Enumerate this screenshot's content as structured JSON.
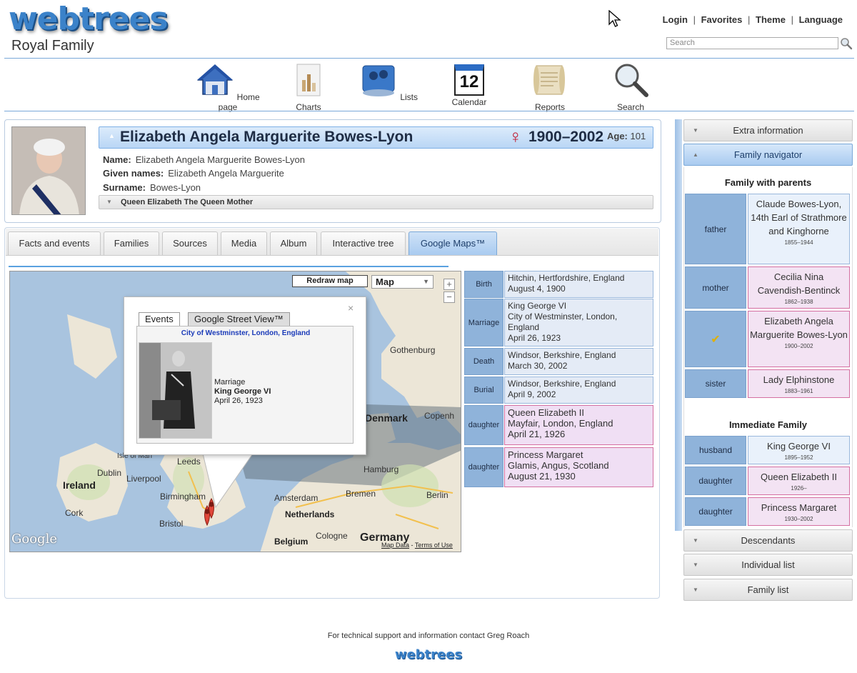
{
  "header": {
    "logo": "webtrees",
    "site_title": "Royal Family",
    "links": [
      "Login",
      "Favorites",
      "Theme",
      "Language"
    ],
    "search_placeholder": "Search"
  },
  "menu": [
    {
      "label": "Home page",
      "icon": "home-icon"
    },
    {
      "label": "Charts",
      "icon": "charts-icon"
    },
    {
      "label": "Lists",
      "icon": "lists-icon"
    },
    {
      "label": "Calendar",
      "icon": "calendar-icon",
      "day": "12"
    },
    {
      "label": "Reports",
      "icon": "reports-icon"
    },
    {
      "label": "Search",
      "icon": "search-icon"
    }
  ],
  "individual": {
    "name": "Elizabeth Angela Marguerite Bowes-Lyon",
    "sex_symbol": "♀",
    "life_span": "1900–2002",
    "age_label": "Age:",
    "age": "101",
    "facts": [
      {
        "label": "Name:",
        "value": "Elizabeth Angela Marguerite Bowes-Lyon"
      },
      {
        "label": "Given names:",
        "value": "Elizabeth Angela Marguerite"
      },
      {
        "label": "Surname:",
        "value": "Bowes-Lyon"
      }
    ],
    "title_bar": "Queen Elizabeth The Queen Mother"
  },
  "tabs": [
    "Facts and events",
    "Families",
    "Sources",
    "Media",
    "Album",
    "Interactive tree",
    "Google Maps™"
  ],
  "active_tab": "Google Maps™",
  "map": {
    "redraw_label": "Redraw map",
    "map_type": "Map",
    "zoom_in": "+",
    "zoom_out": "−",
    "google_logo": "Google",
    "footer_links": [
      "Map Data",
      "Terms of Use"
    ],
    "labels": [
      {
        "text": "Gothenburg",
        "big": false
      },
      {
        "text": "Denmark",
        "big": true
      },
      {
        "text": "Copenh",
        "big": false
      },
      {
        "text": "Isle of Man",
        "big": false
      },
      {
        "text": "Leeds",
        "big": false
      },
      {
        "text": "Dublin",
        "big": false
      },
      {
        "text": "Liverpool",
        "big": false
      },
      {
        "text": "Ireland",
        "big": true
      },
      {
        "text": "Hamburg",
        "big": false
      },
      {
        "text": "Bremen",
        "big": false
      },
      {
        "text": "Berlin",
        "big": false
      },
      {
        "text": "Amsterdam",
        "big": false
      },
      {
        "text": "Birmingham",
        "big": false
      },
      {
        "text": "Netherlands",
        "big": true
      },
      {
        "text": "Cork",
        "big": false
      },
      {
        "text": "Bristol",
        "big": false
      },
      {
        "text": "Cologne",
        "big": false
      },
      {
        "text": "Belgium",
        "big": true
      },
      {
        "text": "Germany",
        "big": true
      }
    ],
    "popup": {
      "tabs": [
        "Events",
        "Google Street View™"
      ],
      "place": "City of Westminster, London, England",
      "event": "Marriage",
      "person": "King George VI",
      "date": "April 26, 1923",
      "close": "×"
    }
  },
  "events": [
    {
      "type": "Birth",
      "lines": [
        "Hitchin, Hertfordshire, England",
        "August 4, 1900"
      ],
      "female": false
    },
    {
      "type": "Marriage",
      "lines": [
        "King George VI",
        "City of Westminster, London,",
        "England",
        "April 26, 1923"
      ],
      "female": false
    },
    {
      "type": "Death",
      "lines": [
        "Windsor, Berkshire, England",
        "March 30, 2002"
      ],
      "female": false
    },
    {
      "type": "Burial",
      "lines": [
        "Windsor, Berkshire, England",
        "April 9, 2002"
      ],
      "female": false
    },
    {
      "type": "daughter",
      "lines": [
        "Queen Elizabeth II",
        "Mayfair, London, England",
        "April 21, 1926"
      ],
      "female": true
    },
    {
      "type": "daughter",
      "lines": [
        "Princess Margaret",
        "Glamis, Angus, Scotland",
        "August 21, 1930"
      ],
      "female": true
    }
  ],
  "sidebar": {
    "sections": [
      "Extra information",
      "Family navigator",
      "Descendants",
      "Individual list",
      "Family list"
    ],
    "active_section": "Family navigator",
    "family_with_parents_title": "Family with parents",
    "parents_family": [
      {
        "relation": "father",
        "name": "Claude Bowes-Lyon, 14th Earl of Strathmore and Kinghorne",
        "dates": "1855–1944",
        "female": false
      },
      {
        "relation": "mother",
        "name": "Cecilia Nina Cavendish-Bentinck",
        "dates": "1862–1938",
        "female": true
      },
      {
        "relation": "",
        "name": "Elizabeth Angela Marguerite Bowes-Lyon",
        "dates": "1900–2002",
        "female": true,
        "self": true
      },
      {
        "relation": "sister",
        "name": "Lady Elphinstone",
        "dates": "1883–1961",
        "female": true
      }
    ],
    "immediate_family_title": "Immediate Family",
    "immediate_family": [
      {
        "relation": "husband",
        "name": "King George VI",
        "dates": "1895–1952",
        "female": false
      },
      {
        "relation": "daughter",
        "name": "Queen Elizabeth II",
        "dates": "1926–",
        "female": true
      },
      {
        "relation": "daughter",
        "name": "Princess Margaret",
        "dates": "1930–2002",
        "female": true
      }
    ]
  },
  "footer": {
    "text": "For technical support and information contact Greg Roach",
    "logo": "webtrees"
  },
  "colors": {
    "accent": "#3b82c9",
    "male_box": "#e9f1fb",
    "female_box": "#f3e3f3",
    "female_border": "#d46fa1",
    "label_cell": "#8fb3da"
  }
}
